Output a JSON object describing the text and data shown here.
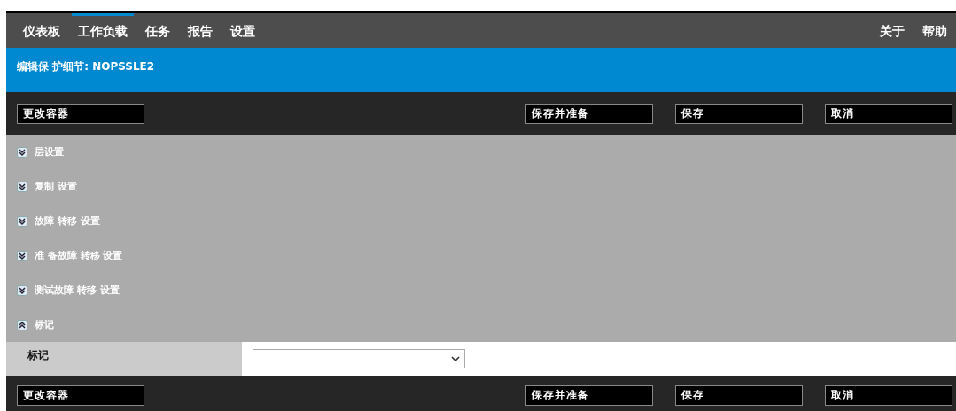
{
  "nav": {
    "tabs": [
      {
        "label": "仪表板",
        "selected": false
      },
      {
        "label": "工作负载",
        "selected": true
      },
      {
        "label": "任务",
        "selected": false
      },
      {
        "label": "报告",
        "selected": false
      },
      {
        "label": "设置",
        "selected": false
      }
    ],
    "links": [
      "关于",
      "帮助"
    ]
  },
  "header": {
    "title": "编辑保 护细节: NOPSSLE2"
  },
  "top_toolbar": {
    "left_buttons": [
      "更改容器"
    ],
    "right_buttons": [
      "保存并准备",
      "保存",
      "取消"
    ]
  },
  "sections": [
    {
      "label": "层设置",
      "expanded": false
    },
    {
      "label": "复制 设置",
      "expanded": false
    },
    {
      "label": "故障 转移 设置",
      "expanded": false
    },
    {
      "label": "准 备故障 转移 设置",
      "expanded": false
    },
    {
      "label": "测试故障 转移 设置",
      "expanded": false
    },
    {
      "label": "标记",
      "expanded": true
    }
  ],
  "tag_field": {
    "label": "标记"
  },
  "bottom_toolbar": {
    "left_buttons": [
      "更改容器"
    ],
    "right_buttons": [
      "保存并准备",
      "保存",
      "取消"
    ]
  }
}
